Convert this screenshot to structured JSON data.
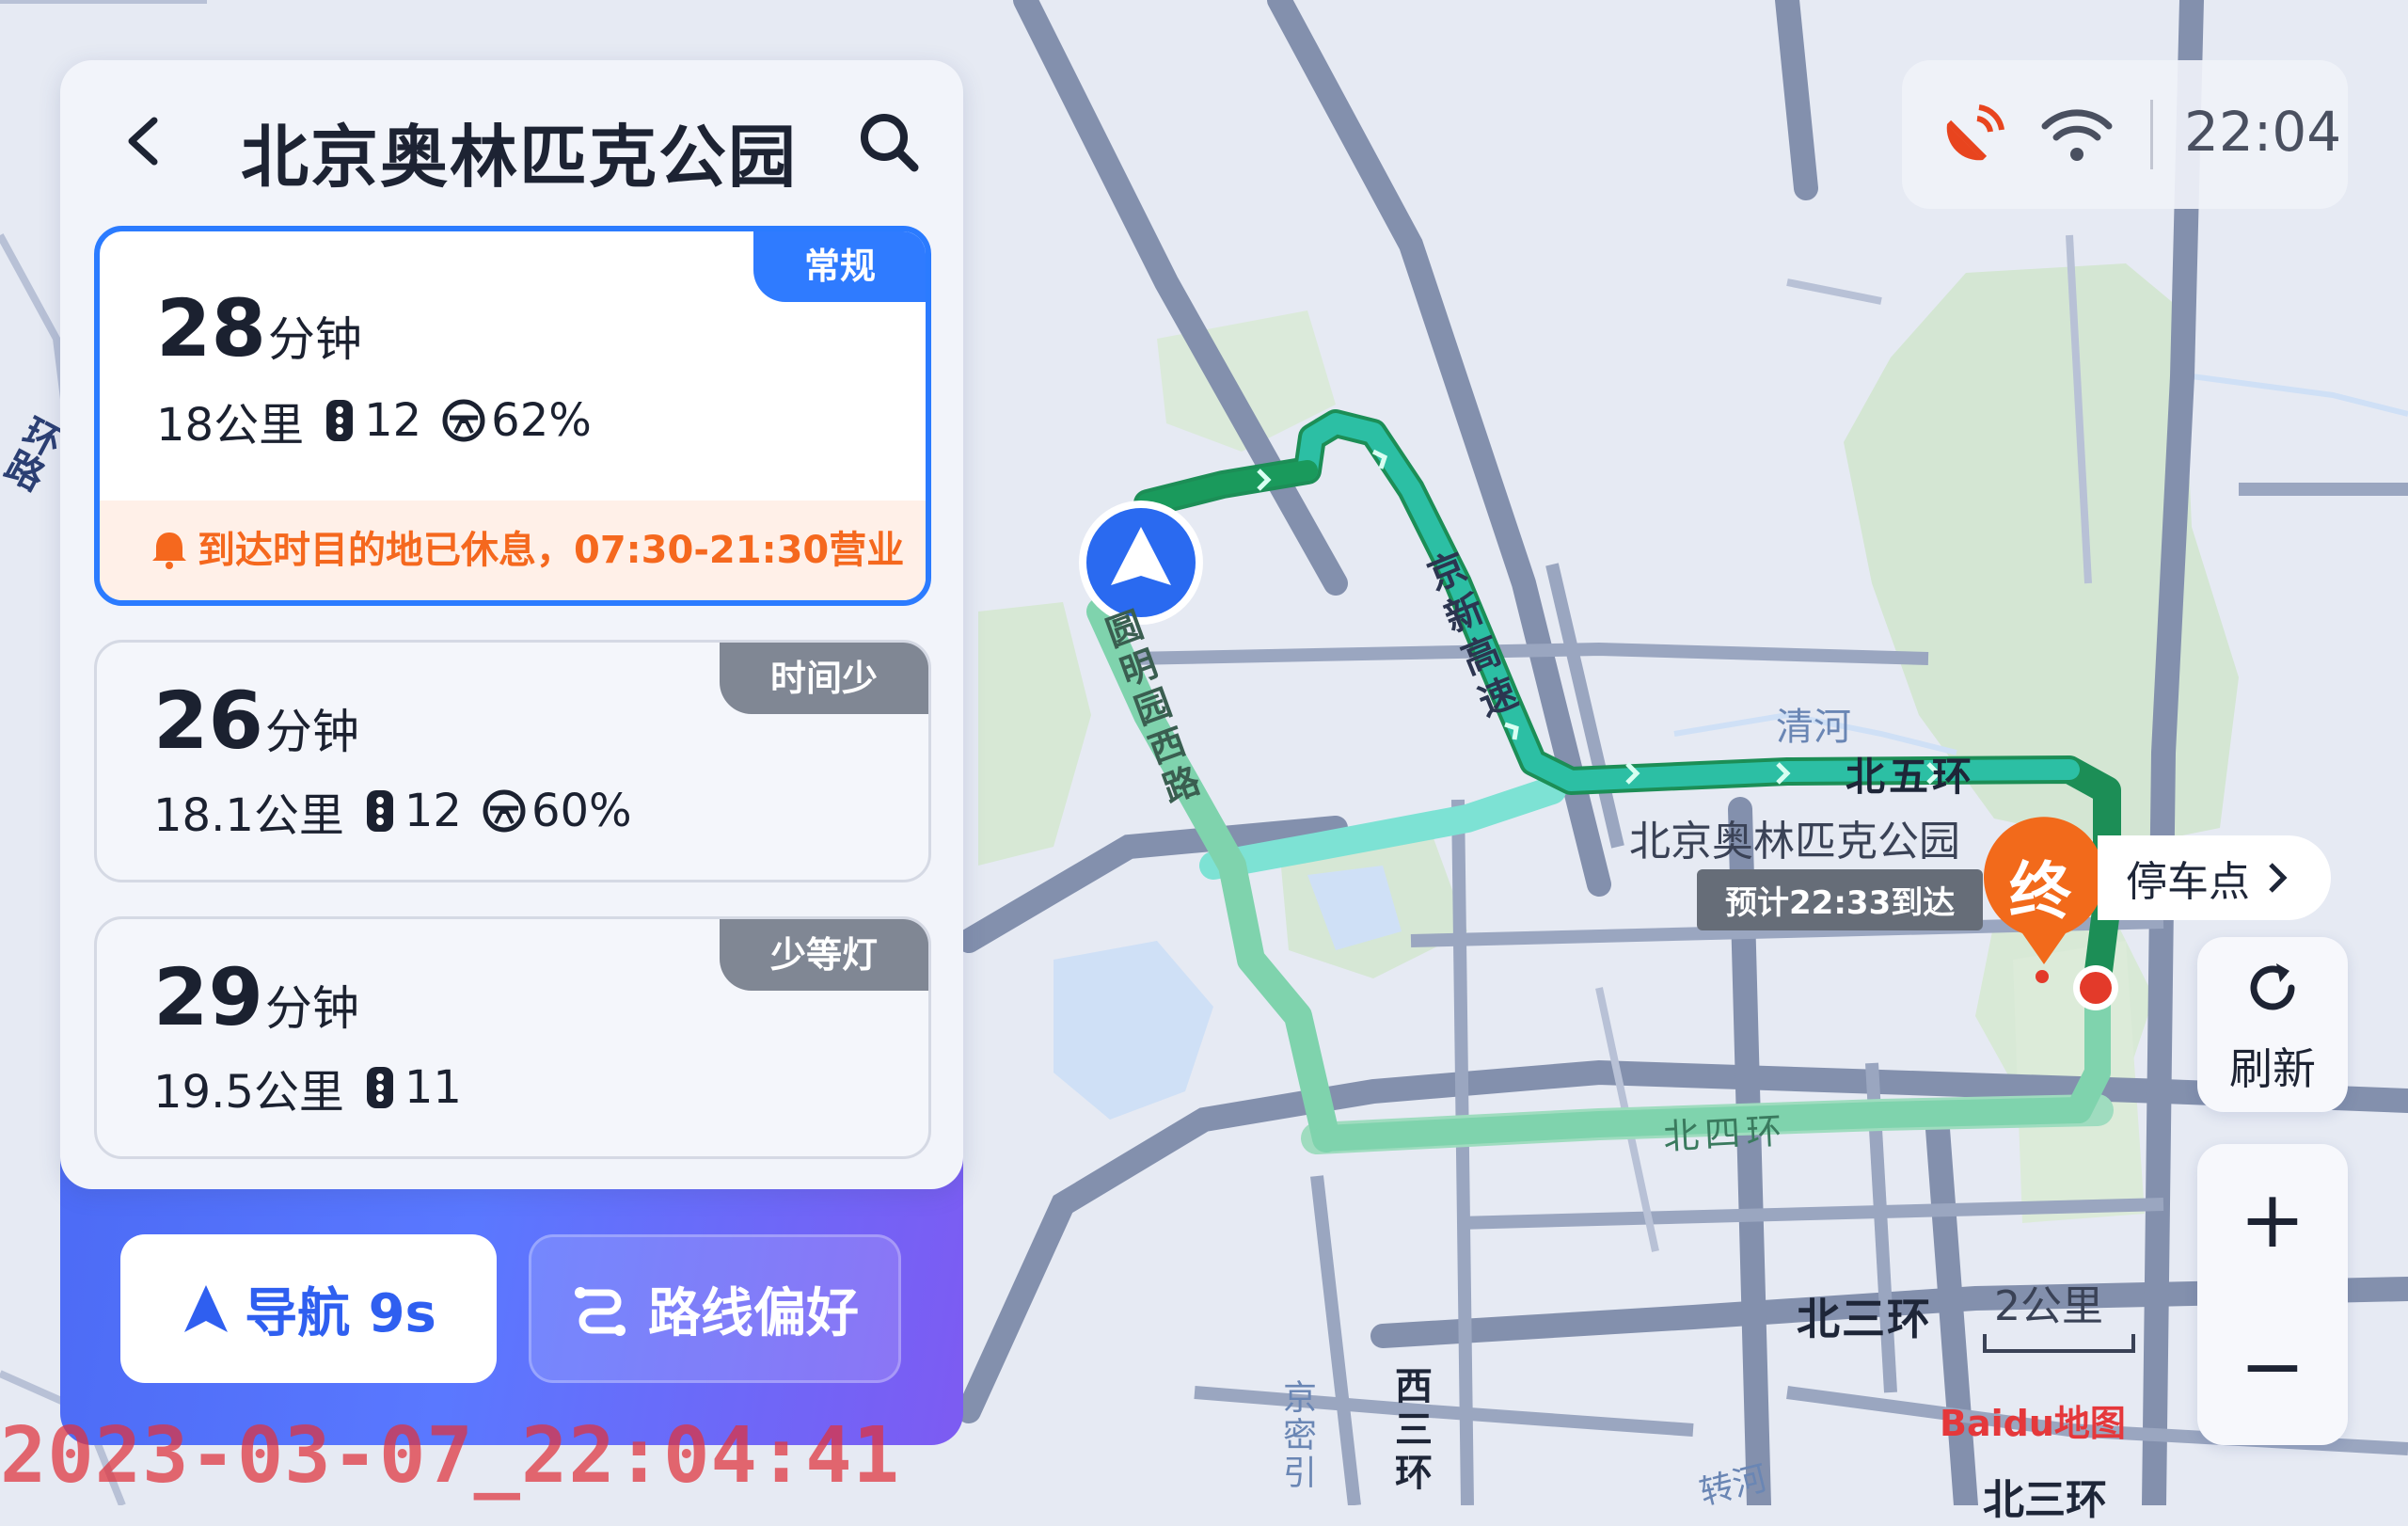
{
  "header": {
    "title": "北京奥林匹克公园"
  },
  "routes": [
    {
      "tag": "常规",
      "minutes": "28",
      "unit": "分钟",
      "distance": "18公里",
      "lights": "12",
      "smooth": "62%",
      "warning": "到达时目的地已休息，07:30-21:30营业",
      "selected": true
    },
    {
      "tag": "时间少",
      "minutes": "26",
      "unit": "分钟",
      "distance": "18.1公里",
      "lights": "12",
      "smooth": "60%",
      "selected": false
    },
    {
      "tag": "少等灯",
      "minutes": "29",
      "unit": "分钟",
      "distance": "19.5公里",
      "lights": "11",
      "selected": false
    }
  ],
  "actions": {
    "navigate": "导航 9s",
    "preference": "路线偏好"
  },
  "status": {
    "time": "22:04"
  },
  "map": {
    "labels": {
      "jingxin": "京新高速",
      "yuanming": "圆明园西路",
      "qinghe": "清河",
      "bei5": "北五环",
      "bei4": "北四环",
      "bei3": "北三环",
      "bei3b": "北三环",
      "xisan": "西三环",
      "jingmi": "京密引",
      "zhuanhe": "转河",
      "huan_left": "环路",
      "dest_name": "北京奥林匹克公园",
      "eta": "预计22:33到达",
      "end_marker": "终",
      "parking": "停车点",
      "scale": "2公里",
      "logo": "Baidu地图"
    }
  },
  "controls": {
    "refresh": "刷新",
    "zoom_in": "+",
    "zoom_out": "−"
  },
  "overlay": {
    "timestamp": "2023-03-07_22:04:41"
  },
  "colors": {
    "accent": "#2f7bff",
    "route_green": "#17a867",
    "route_teal": "#36c6a5",
    "end_orange": "#f26a1b",
    "warning": "#f5681e"
  }
}
